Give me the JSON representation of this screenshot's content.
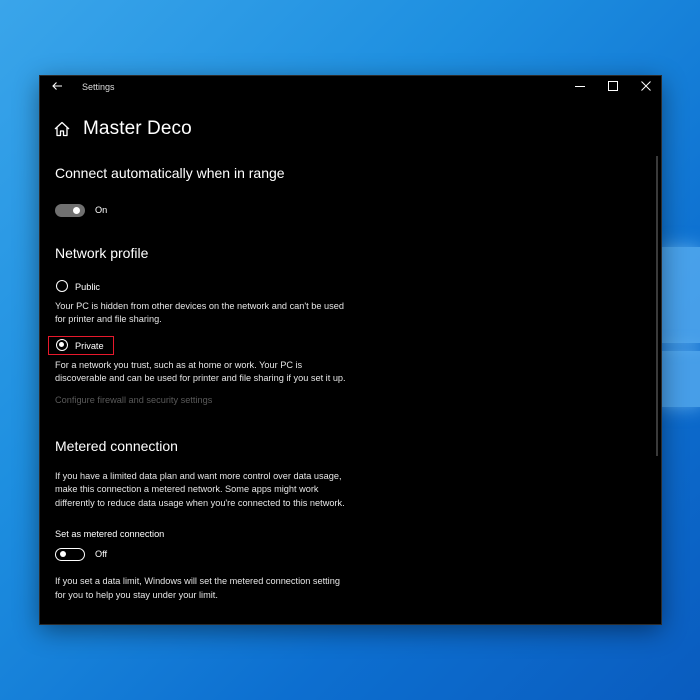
{
  "window": {
    "title": "Settings",
    "back_icon": "arrow-left-icon",
    "min_glyph": "—",
    "max_glyph": "☐",
    "close_glyph": "✕"
  },
  "page": {
    "title": "Master Deco",
    "home_icon": "home-icon"
  },
  "auto_connect": {
    "heading": "Connect automatically when in range",
    "state_label": "On",
    "state": true
  },
  "network_profile": {
    "heading": "Network profile",
    "public_label": "Public",
    "public_desc_1": "Your PC is hidden from other devices on the network and can't be used",
    "public_desc_2": "for printer and file sharing.",
    "private_label": "Private",
    "private_desc_1": "For a network you trust, such as at home or work. Your PC is",
    "private_desc_2": "discoverable and can be used for printer and file sharing if you set it up.",
    "selected": "Private",
    "firewall_link": "Configure firewall and security settings"
  },
  "metered": {
    "heading": "Metered connection",
    "desc_1": "If you have a limited data plan and want more control over data usage,",
    "desc_2": "make this connection a metered network. Some apps might work",
    "desc_3": "differently to reduce data usage when you're connected to this network.",
    "set_label": "Set as metered connection",
    "state_label": "Off",
    "state": false,
    "limit_desc_1": "If you set a data limit, Windows will set the metered connection setting",
    "limit_desc_2": "for you to help you stay under your limit."
  },
  "colors": {
    "highlight": "#e8192c",
    "background": "#000000",
    "desktop": "#1e8fe0"
  }
}
